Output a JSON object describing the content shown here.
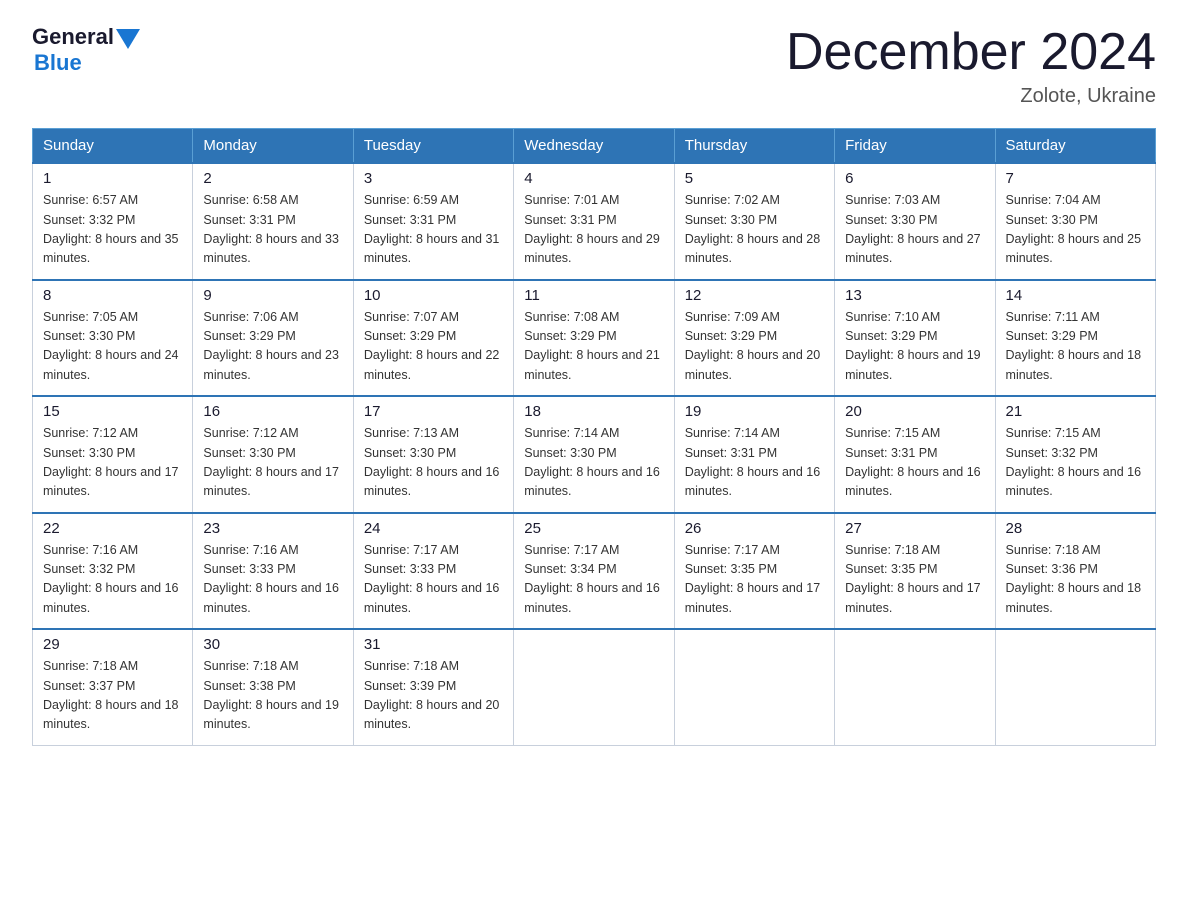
{
  "header": {
    "logo_general": "General",
    "logo_blue": "Blue",
    "title": "December 2024",
    "subtitle": "Zolote, Ukraine"
  },
  "weekdays": [
    "Sunday",
    "Monday",
    "Tuesday",
    "Wednesday",
    "Thursday",
    "Friday",
    "Saturday"
  ],
  "weeks": [
    [
      {
        "day": "1",
        "sunrise": "6:57 AM",
        "sunset": "3:32 PM",
        "daylight": "8 hours and 35 minutes."
      },
      {
        "day": "2",
        "sunrise": "6:58 AM",
        "sunset": "3:31 PM",
        "daylight": "8 hours and 33 minutes."
      },
      {
        "day": "3",
        "sunrise": "6:59 AM",
        "sunset": "3:31 PM",
        "daylight": "8 hours and 31 minutes."
      },
      {
        "day": "4",
        "sunrise": "7:01 AM",
        "sunset": "3:31 PM",
        "daylight": "8 hours and 29 minutes."
      },
      {
        "day": "5",
        "sunrise": "7:02 AM",
        "sunset": "3:30 PM",
        "daylight": "8 hours and 28 minutes."
      },
      {
        "day": "6",
        "sunrise": "7:03 AM",
        "sunset": "3:30 PM",
        "daylight": "8 hours and 27 minutes."
      },
      {
        "day": "7",
        "sunrise": "7:04 AM",
        "sunset": "3:30 PM",
        "daylight": "8 hours and 25 minutes."
      }
    ],
    [
      {
        "day": "8",
        "sunrise": "7:05 AM",
        "sunset": "3:30 PM",
        "daylight": "8 hours and 24 minutes."
      },
      {
        "day": "9",
        "sunrise": "7:06 AM",
        "sunset": "3:29 PM",
        "daylight": "8 hours and 23 minutes."
      },
      {
        "day": "10",
        "sunrise": "7:07 AM",
        "sunset": "3:29 PM",
        "daylight": "8 hours and 22 minutes."
      },
      {
        "day": "11",
        "sunrise": "7:08 AM",
        "sunset": "3:29 PM",
        "daylight": "8 hours and 21 minutes."
      },
      {
        "day": "12",
        "sunrise": "7:09 AM",
        "sunset": "3:29 PM",
        "daylight": "8 hours and 20 minutes."
      },
      {
        "day": "13",
        "sunrise": "7:10 AM",
        "sunset": "3:29 PM",
        "daylight": "8 hours and 19 minutes."
      },
      {
        "day": "14",
        "sunrise": "7:11 AM",
        "sunset": "3:29 PM",
        "daylight": "8 hours and 18 minutes."
      }
    ],
    [
      {
        "day": "15",
        "sunrise": "7:12 AM",
        "sunset": "3:30 PM",
        "daylight": "8 hours and 17 minutes."
      },
      {
        "day": "16",
        "sunrise": "7:12 AM",
        "sunset": "3:30 PM",
        "daylight": "8 hours and 17 minutes."
      },
      {
        "day": "17",
        "sunrise": "7:13 AM",
        "sunset": "3:30 PM",
        "daylight": "8 hours and 16 minutes."
      },
      {
        "day": "18",
        "sunrise": "7:14 AM",
        "sunset": "3:30 PM",
        "daylight": "8 hours and 16 minutes."
      },
      {
        "day": "19",
        "sunrise": "7:14 AM",
        "sunset": "3:31 PM",
        "daylight": "8 hours and 16 minutes."
      },
      {
        "day": "20",
        "sunrise": "7:15 AM",
        "sunset": "3:31 PM",
        "daylight": "8 hours and 16 minutes."
      },
      {
        "day": "21",
        "sunrise": "7:15 AM",
        "sunset": "3:32 PM",
        "daylight": "8 hours and 16 minutes."
      }
    ],
    [
      {
        "day": "22",
        "sunrise": "7:16 AM",
        "sunset": "3:32 PM",
        "daylight": "8 hours and 16 minutes."
      },
      {
        "day": "23",
        "sunrise": "7:16 AM",
        "sunset": "3:33 PM",
        "daylight": "8 hours and 16 minutes."
      },
      {
        "day": "24",
        "sunrise": "7:17 AM",
        "sunset": "3:33 PM",
        "daylight": "8 hours and 16 minutes."
      },
      {
        "day": "25",
        "sunrise": "7:17 AM",
        "sunset": "3:34 PM",
        "daylight": "8 hours and 16 minutes."
      },
      {
        "day": "26",
        "sunrise": "7:17 AM",
        "sunset": "3:35 PM",
        "daylight": "8 hours and 17 minutes."
      },
      {
        "day": "27",
        "sunrise": "7:18 AM",
        "sunset": "3:35 PM",
        "daylight": "8 hours and 17 minutes."
      },
      {
        "day": "28",
        "sunrise": "7:18 AM",
        "sunset": "3:36 PM",
        "daylight": "8 hours and 18 minutes."
      }
    ],
    [
      {
        "day": "29",
        "sunrise": "7:18 AM",
        "sunset": "3:37 PM",
        "daylight": "8 hours and 18 minutes."
      },
      {
        "day": "30",
        "sunrise": "7:18 AM",
        "sunset": "3:38 PM",
        "daylight": "8 hours and 19 minutes."
      },
      {
        "day": "31",
        "sunrise": "7:18 AM",
        "sunset": "3:39 PM",
        "daylight": "8 hours and 20 minutes."
      },
      null,
      null,
      null,
      null
    ]
  ]
}
